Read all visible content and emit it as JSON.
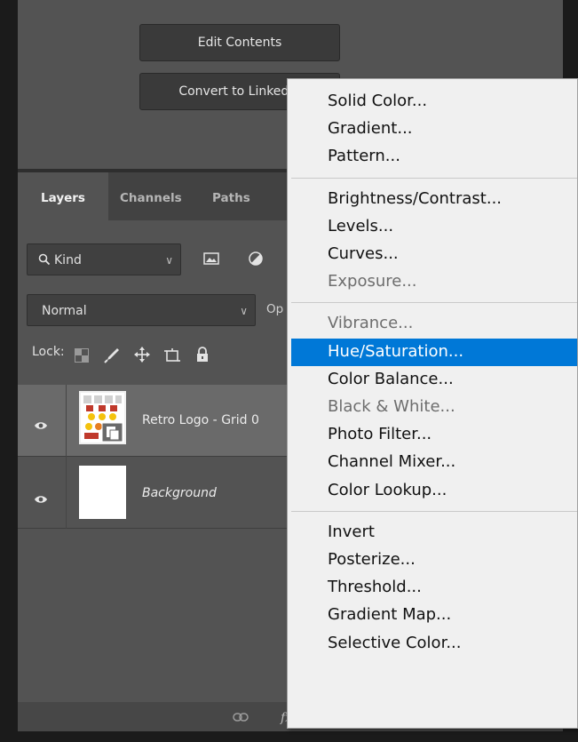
{
  "properties": {
    "edit_contents_label": "Edit Contents",
    "convert_label": "Convert to Linked..."
  },
  "layers_panel": {
    "tabs": [
      {
        "label": "Layers",
        "active": true
      },
      {
        "label": "Channels",
        "active": false
      },
      {
        "label": "Paths",
        "active": false
      }
    ],
    "filter_kind": "Kind",
    "blend_mode": "Normal",
    "opacity_label": "Op",
    "lock_label": "Lock:",
    "layers": [
      {
        "name": "Retro Logo - Grid 0",
        "visible": true,
        "selected": true,
        "italic": false
      },
      {
        "name": "Background",
        "visible": true,
        "selected": false,
        "italic": true
      }
    ],
    "bottom_icons": [
      "link-icon",
      "fx-icon",
      "mask-icon",
      "adjustment-layer-icon",
      "group-icon",
      "new-layer-icon",
      "trash-icon"
    ]
  },
  "menu": {
    "groups": [
      [
        {
          "label": "Solid Color...",
          "enabled": true
        },
        {
          "label": "Gradient...",
          "enabled": true
        },
        {
          "label": "Pattern...",
          "enabled": true
        }
      ],
      [
        {
          "label": "Brightness/Contrast...",
          "enabled": true
        },
        {
          "label": "Levels...",
          "enabled": true
        },
        {
          "label": "Curves...",
          "enabled": true
        },
        {
          "label": "Exposure...",
          "enabled": false
        }
      ],
      [
        {
          "label": "Vibrance...",
          "enabled": false
        },
        {
          "label": "Hue/Saturation...",
          "enabled": true,
          "highlighted": true
        },
        {
          "label": "Color Balance...",
          "enabled": true
        },
        {
          "label": "Black & White...",
          "enabled": false
        },
        {
          "label": "Photo Filter...",
          "enabled": true
        },
        {
          "label": "Channel Mixer...",
          "enabled": true
        },
        {
          "label": "Color Lookup...",
          "enabled": true
        }
      ],
      [
        {
          "label": "Invert",
          "enabled": true
        },
        {
          "label": "Posterize...",
          "enabled": true
        },
        {
          "label": "Threshold...",
          "enabled": true
        },
        {
          "label": "Gradient Map...",
          "enabled": true
        },
        {
          "label": "Selective Color...",
          "enabled": true
        }
      ]
    ]
  },
  "colors": {
    "menu_highlight": "#0078d7",
    "panel_bg": "#535353",
    "selected_layer_bg": "#6a6a6a"
  }
}
